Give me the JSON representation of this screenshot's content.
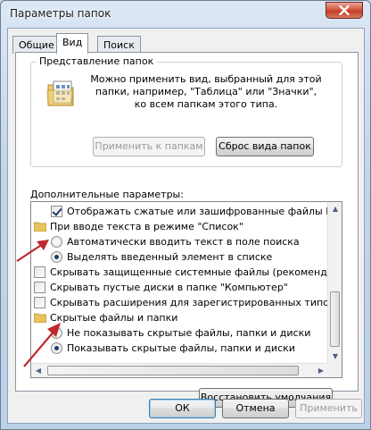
{
  "window": {
    "title": "Параметры папок"
  },
  "tabs": [
    {
      "label": "Общие",
      "active": false
    },
    {
      "label": "Вид",
      "active": true
    },
    {
      "label": "Поиск",
      "active": false
    }
  ],
  "folder_view": {
    "legend": "Представление папок",
    "description_lines": [
      "Можно применить вид, выбранный для этой",
      "папки, например, \"Таблица\" или \"Значки\",",
      "ко всем папкам этого типа."
    ],
    "apply_button": "Применить к папкам",
    "reset_button": "Сброс вида папок"
  },
  "advanced": {
    "label": "Дополнительные параметры:",
    "items": [
      {
        "type": "checkbox",
        "checked": true,
        "indent": 0,
        "label": "Отображать сжатые или зашифрованные файлы NTFS"
      },
      {
        "type": "folder",
        "indent": 0,
        "label": "При вводе текста в режиме \"Список\""
      },
      {
        "type": "radio",
        "checked": false,
        "indent": 1,
        "label": "Автоматически вводить текст в поле поиска"
      },
      {
        "type": "radio",
        "checked": true,
        "indent": 1,
        "label": "Выделять введенный элемент в списке"
      },
      {
        "type": "checkbox",
        "checked": false,
        "indent": 0,
        "label": "Скрывать защищенные системные файлы (рекомендуется)"
      },
      {
        "type": "checkbox",
        "checked": false,
        "indent": 0,
        "label": "Скрывать пустые диски в папке \"Компьютер\""
      },
      {
        "type": "checkbox",
        "checked": false,
        "indent": 0,
        "label": "Скрывать расширения для зарегистрированных типов"
      },
      {
        "type": "folder",
        "indent": 0,
        "label": "Скрытые файлы и папки"
      },
      {
        "type": "radio",
        "checked": false,
        "indent": 1,
        "label": "Не показывать скрытые файлы, папки и диски"
      },
      {
        "type": "radio",
        "checked": true,
        "indent": 1,
        "label": "Показывать скрытые файлы, папки и диски"
      }
    ],
    "restore_button": "Восстановить умолчания"
  },
  "footer": {
    "ok": "ОК",
    "cancel": "Отмена",
    "apply": "Применить"
  },
  "colors": {
    "annotation_arrow": "#c0282c"
  }
}
